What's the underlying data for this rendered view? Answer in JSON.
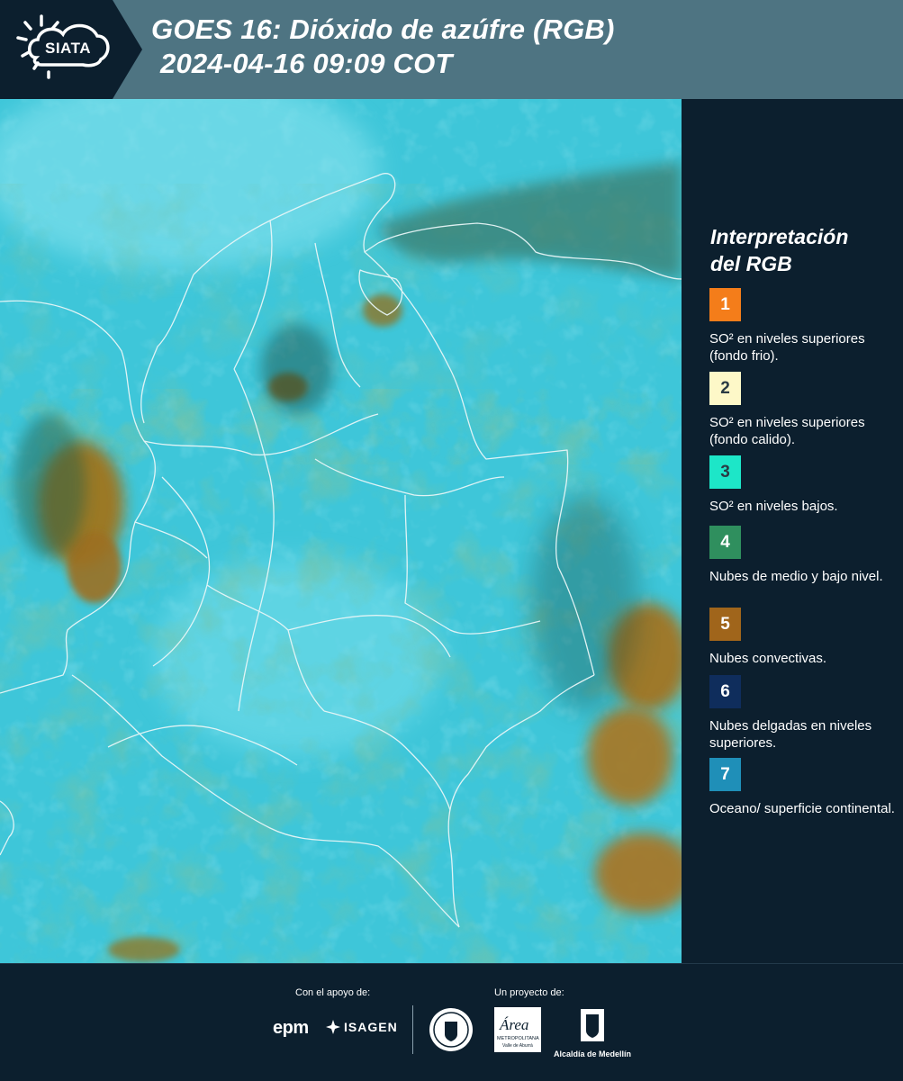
{
  "header": {
    "logo_text": "SIATA",
    "title_line1": "GOES 16: Dióxido de azúfre (RGB)",
    "title_line2": "2024-04-16 09:09 COT"
  },
  "legend": {
    "title_line1": "Interpretación",
    "title_line2": "del RGB",
    "items": [
      {
        "number": "1",
        "label": "SO² en niveles superiores (fondo frio).",
        "color": "#f47d1a"
      },
      {
        "number": "2",
        "label": "SO² en niveles superiores (fondo calido).",
        "color": "#fdf8c8"
      },
      {
        "number": "3",
        "label": "SO² en niveles bajos.",
        "color": "#1de6c8"
      },
      {
        "number": "4",
        "label": "Nubes de medio y bajo nivel.",
        "color": "#2f8f5e"
      },
      {
        "number": "5",
        "label": "Nubes convectivas.",
        "color": "#a0651b"
      },
      {
        "number": "6",
        "label": "Nubes delgadas en niveles superiores.",
        "color": "#0f2d5c"
      },
      {
        "number": "7",
        "label": "Oceano/ superficie continental.",
        "color": "#1f8fb8"
      }
    ]
  },
  "footer": {
    "support_caption": "Con el apoyo de:",
    "project_caption": "Un proyecto de:",
    "epm_logo": "epm",
    "isagen_logo": "ISAGEN",
    "amva_logo": "Área",
    "amva_sub1": "METROPOLITANA",
    "amva_sub2": "Valle de Aburrá",
    "alcaldia_logo": "Alcaldía de Medellín"
  },
  "colors": {
    "header_bg": "#4e7482",
    "header_dark": "#0c1f2e",
    "page_bg": "#0c1f2e",
    "ocean": "#37c3d8",
    "land_green": "#3f9a6e",
    "convective_brown": "#a0741f"
  }
}
